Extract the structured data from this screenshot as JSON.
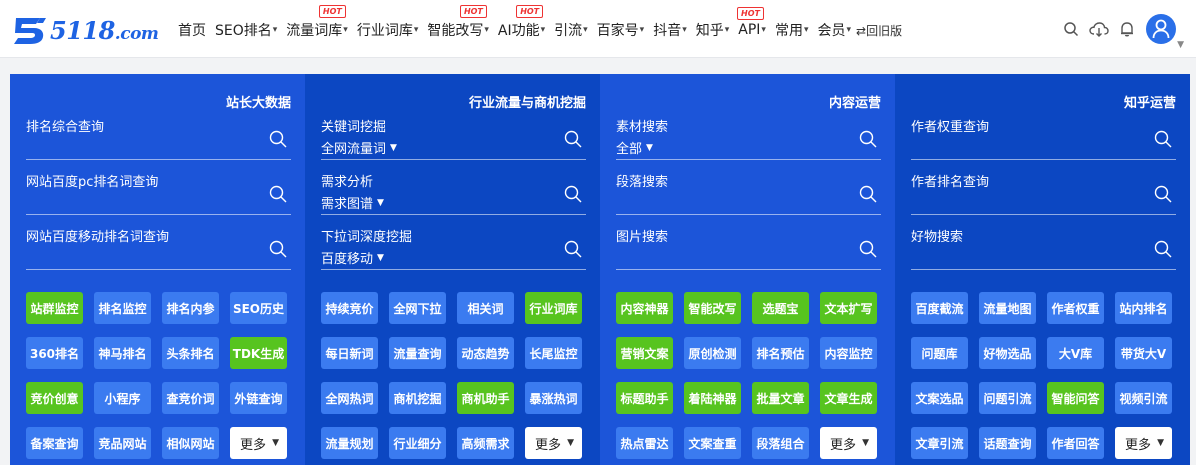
{
  "logo": {
    "text_main": "5118",
    "text_domain": ".com"
  },
  "nav": {
    "items": [
      {
        "label": "首页",
        "caret": false,
        "hot": false
      },
      {
        "label": "SEO排名",
        "caret": true,
        "hot": false
      },
      {
        "label": "流量词库",
        "caret": true,
        "hot": true
      },
      {
        "label": "行业词库",
        "caret": true,
        "hot": false
      },
      {
        "label": "智能改写",
        "caret": true,
        "hot": true
      },
      {
        "label": "AI功能",
        "caret": true,
        "hot": true
      },
      {
        "label": "引流",
        "caret": true,
        "hot": false
      },
      {
        "label": "百家号",
        "caret": true,
        "hot": false
      },
      {
        "label": "抖音",
        "caret": true,
        "hot": false
      },
      {
        "label": "知乎",
        "caret": true,
        "hot": false
      },
      {
        "label": "API",
        "caret": true,
        "hot": true
      },
      {
        "label": "常用",
        "caret": true,
        "hot": false
      },
      {
        "label": "会员",
        "caret": true,
        "hot": false
      }
    ],
    "hot_label": "HOT",
    "old_version": "⇄回旧版"
  },
  "tools": [
    "search-icon",
    "cloud-download-icon",
    "bell-icon",
    "user-avatar-icon"
  ],
  "colors": {
    "brand": "#1e63e3",
    "panel_light": "#1c55d9",
    "panel_dark": "#0c47c2",
    "button_blue": "#3b7bf0",
    "button_green": "#57c41f",
    "hot_red": "#e33333"
  },
  "panels": [
    {
      "title": "站长大数据",
      "dark": false,
      "fields": [
        {
          "label": "排名综合查询",
          "select": ""
        },
        {
          "label": "网站百度pc排名词查询",
          "select": ""
        },
        {
          "label": "网站百度移动排名词查询",
          "select": ""
        }
      ],
      "buttons": [
        {
          "label": "站群监控",
          "green": true
        },
        {
          "label": "排名监控",
          "green": false
        },
        {
          "label": "排名内参",
          "green": false
        },
        {
          "label": "SEO历史",
          "green": false
        },
        {
          "label": "360排名",
          "green": false
        },
        {
          "label": "神马排名",
          "green": false
        },
        {
          "label": "头条排名",
          "green": false
        },
        {
          "label": "TDK生成",
          "green": true
        },
        {
          "label": "竞价创意",
          "green": true
        },
        {
          "label": "小程序",
          "green": false
        },
        {
          "label": "查竞价词",
          "green": false
        },
        {
          "label": "外链查询",
          "green": false
        },
        {
          "label": "备案查询",
          "green": false
        },
        {
          "label": "竞品网站",
          "green": false
        },
        {
          "label": "相似网站",
          "green": false
        },
        {
          "label": "更多",
          "more": true
        }
      ]
    },
    {
      "title": "行业流量与商机挖掘",
      "dark": true,
      "fields": [
        {
          "label": "关键词挖掘",
          "select": "全网流量词"
        },
        {
          "label": "需求分析",
          "select": "需求图谱"
        },
        {
          "label": "下拉词深度挖掘",
          "select": "百度移动"
        }
      ],
      "buttons": [
        {
          "label": "持续竞价",
          "green": false
        },
        {
          "label": "全网下拉",
          "green": false
        },
        {
          "label": "相关词",
          "green": false
        },
        {
          "label": "行业词库",
          "green": true
        },
        {
          "label": "每日新词",
          "green": false
        },
        {
          "label": "流量查询",
          "green": false
        },
        {
          "label": "动态趋势",
          "green": false
        },
        {
          "label": "长尾监控",
          "green": false
        },
        {
          "label": "全网热词",
          "green": false
        },
        {
          "label": "商机挖掘",
          "green": false
        },
        {
          "label": "商机助手",
          "green": true
        },
        {
          "label": "暴涨热词",
          "green": false
        },
        {
          "label": "流量规划",
          "green": false
        },
        {
          "label": "行业细分",
          "green": false
        },
        {
          "label": "高频需求",
          "green": false
        },
        {
          "label": "更多",
          "more": true
        }
      ]
    },
    {
      "title": "内容运营",
      "dark": false,
      "fields": [
        {
          "label": "素材搜索",
          "select": "全部"
        },
        {
          "label": "段落搜索",
          "select": ""
        },
        {
          "label": "图片搜索",
          "select": ""
        }
      ],
      "buttons": [
        {
          "label": "内容神器",
          "green": true
        },
        {
          "label": "智能改写",
          "green": true
        },
        {
          "label": "选题宝",
          "green": true
        },
        {
          "label": "文本扩写",
          "green": true
        },
        {
          "label": "营销文案",
          "green": true
        },
        {
          "label": "原创检测",
          "green": false
        },
        {
          "label": "排名预估",
          "green": false
        },
        {
          "label": "内容监控",
          "green": false
        },
        {
          "label": "标题助手",
          "green": true
        },
        {
          "label": "着陆神器",
          "green": true
        },
        {
          "label": "批量文章",
          "green": true
        },
        {
          "label": "文章生成",
          "green": true
        },
        {
          "label": "热点雷达",
          "green": false
        },
        {
          "label": "文案查重",
          "green": false
        },
        {
          "label": "段落组合",
          "green": false
        },
        {
          "label": "更多",
          "more": true
        }
      ]
    },
    {
      "title": "知乎运营",
      "dark": true,
      "fields": [
        {
          "label": "作者权重查询",
          "select": ""
        },
        {
          "label": "作者排名查询",
          "select": ""
        },
        {
          "label": "好物搜索",
          "select": ""
        }
      ],
      "buttons": [
        {
          "label": "百度截流",
          "green": false
        },
        {
          "label": "流量地图",
          "green": false
        },
        {
          "label": "作者权重",
          "green": false
        },
        {
          "label": "站内排名",
          "green": false
        },
        {
          "label": "问题库",
          "green": false
        },
        {
          "label": "好物选品",
          "green": false
        },
        {
          "label": "大V库",
          "green": false
        },
        {
          "label": "带货大V",
          "green": false
        },
        {
          "label": "文案选品",
          "green": false
        },
        {
          "label": "问题引流",
          "green": false
        },
        {
          "label": "智能问答",
          "green": true
        },
        {
          "label": "视频引流",
          "green": false
        },
        {
          "label": "文章引流",
          "green": false
        },
        {
          "label": "话题查询",
          "green": false
        },
        {
          "label": "作者回答",
          "green": false
        },
        {
          "label": "更多",
          "more": true
        }
      ]
    }
  ]
}
